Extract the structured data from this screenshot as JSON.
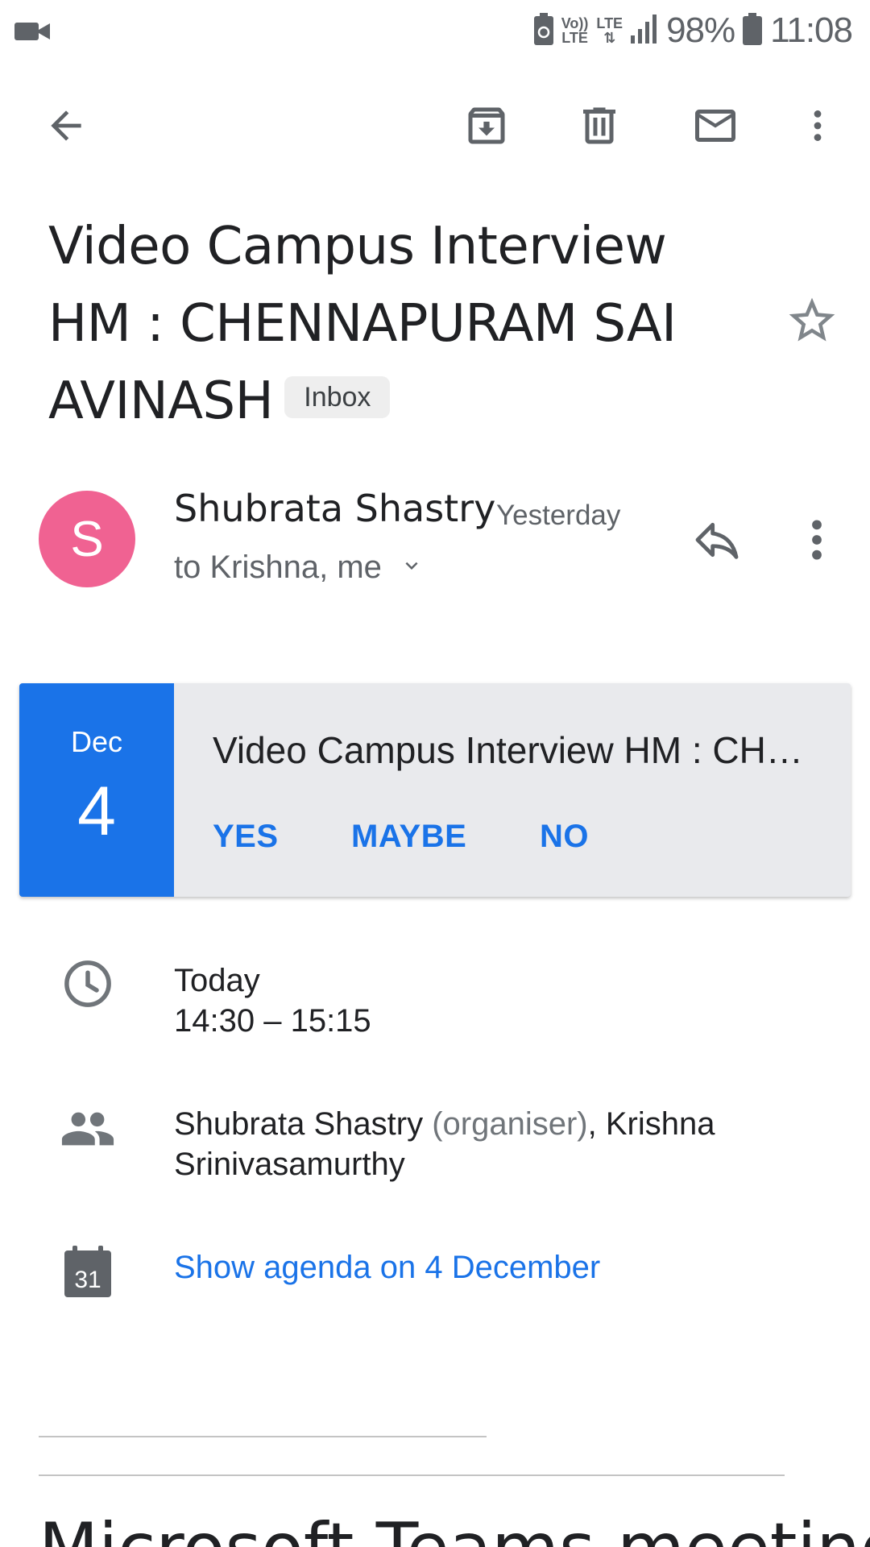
{
  "status_bar": {
    "icons": [
      "video-icon",
      "battery-saver-icon",
      "volte-icon",
      "lte-data-icon",
      "signal-icon",
      "battery-icon"
    ],
    "volte_top": "Vo))",
    "volte_bottom": "LTE",
    "lte_label": "LTE",
    "battery_percent": "98%",
    "time": "11:08"
  },
  "toolbar": {
    "icons": [
      "back-arrow-icon",
      "archive-icon",
      "delete-icon",
      "mark-unread-icon",
      "more-vert-icon"
    ]
  },
  "email": {
    "subject_lines": [
      "Video Campus Interview",
      "HM : CHENNAPURAM SAI",
      "AVINASH"
    ],
    "label_chip": "Inbox",
    "starred": false
  },
  "sender": {
    "avatar_letter": "S",
    "avatar_color": "#f06292",
    "name": "Shubrata Shastry",
    "date": "Yesterday",
    "recipients": "to Krishna, me"
  },
  "event_card": {
    "month": "Dec",
    "day": "4",
    "title": "Video Campus Interview HM : CH…",
    "rsvp_yes": "YES",
    "rsvp_maybe": "MAYBE",
    "rsvp_no": "NO",
    "accent_color": "#1a73e8"
  },
  "details": {
    "when_day": "Today",
    "when_time": "14:30 – 15:15",
    "organiser_name": "Shubrata Shastry",
    "organiser_tag": "(organiser)",
    "attendee_line1": ", Krishna",
    "attendee_line2": "Srinivasamurthy",
    "calendar_day": "31",
    "agenda_link": "Show agenda on 4 December"
  },
  "body": {
    "heading": "Microsoft Teams meeting"
  }
}
